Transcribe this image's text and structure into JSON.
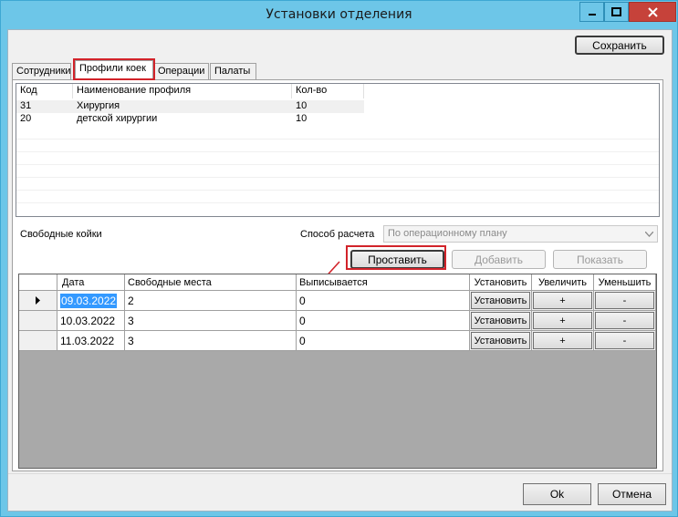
{
  "window": {
    "title": "Установки отделения"
  },
  "toolbar": {
    "save_label": "Сохранить"
  },
  "tabs": [
    {
      "label": "Сотрудники"
    },
    {
      "label": "Профили коек"
    },
    {
      "label": "Операции"
    },
    {
      "label": "Палаты"
    }
  ],
  "profiles": {
    "columns": [
      "Код",
      "Наименование профиля",
      "Кол-во"
    ],
    "rows": [
      {
        "code": "31",
        "name": "Хирургия",
        "count": "10"
      },
      {
        "code": "20",
        "name": "детской хирургии",
        "count": "10"
      }
    ]
  },
  "free_beds": {
    "label": "Свободные койки",
    "calc_label": "Способ расчета",
    "calc_value": "По операционному плану",
    "buttons": {
      "set": "Проставить",
      "add": "Добавить",
      "show": "Показать"
    }
  },
  "grid": {
    "columns": [
      "Дата",
      "Свободные места",
      "Выписывается",
      "Установить",
      "Увеличить",
      "Уменьшить"
    ],
    "rows": [
      {
        "date": "09.03.2022",
        "free": "2",
        "discharged": "0",
        "set": "Установить",
        "inc": "+",
        "dec": "-"
      },
      {
        "date": "10.03.2022",
        "free": "3",
        "discharged": "0",
        "set": "Установить",
        "inc": "+",
        "dec": "-"
      },
      {
        "date": "11.03.2022",
        "free": "3",
        "discharged": "0",
        "set": "Установить",
        "inc": "+",
        "dec": "-"
      }
    ]
  },
  "footer": {
    "ok": "Ok",
    "cancel": "Отмена"
  },
  "colors": {
    "titlebar": "#6dc6e8",
    "close": "#c6423a",
    "selection": "#3399ff",
    "highlight": "#d2232a"
  }
}
